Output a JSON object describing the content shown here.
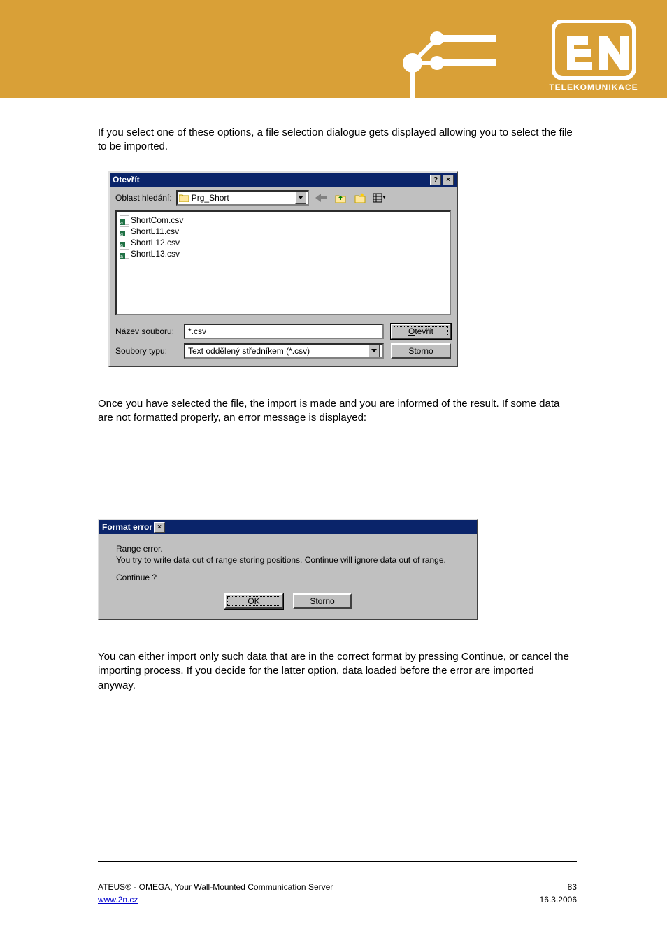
{
  "header": {
    "logo_text": "TELEKOMUNIKACE"
  },
  "paragraphs": {
    "p1": "If you select one of these options, a file selection dialogue gets displayed allowing you to select the file to be imported.",
    "p2": "Once you have selected the file, the import is made and you are informed of the result. If some data are not formatted properly, an error message is displayed:",
    "p3": "You can either import only such data that are in the correct format by pressing Continue, or cancel the importing process. If you decide for the latter option, data loaded before the error are imported anyway."
  },
  "dialog_open": {
    "title": "Otevřít",
    "lookin_label": "Oblast hledání:",
    "lookin_value": "Prg_Short",
    "files": [
      "ShortCom.csv",
      "ShortL11.csv",
      "ShortL12.csv",
      "ShortL13.csv"
    ],
    "filename_label": "Název souboru:",
    "filename_value": "*.csv",
    "filetype_label": "Soubory typu:",
    "filetype_value": "Text oddělený středníkem (*.csv)",
    "open_button": "Otevřít",
    "cancel_button": "Storno"
  },
  "dialog_error": {
    "title": "Format error",
    "line1": "Range error.",
    "line2": "You try to write data out of range storing positions. Continue will ignore data out of range.",
    "line3": "Continue ?",
    "ok_button": "OK",
    "cancel_button": "Storno"
  },
  "footer": {
    "row1_left": "ATEUS® - OMEGA, Your Wall-Mounted Communication Server",
    "row1_right": "83",
    "row2_left": "www.2n.cz",
    "row2_right": "16.3.2006"
  }
}
